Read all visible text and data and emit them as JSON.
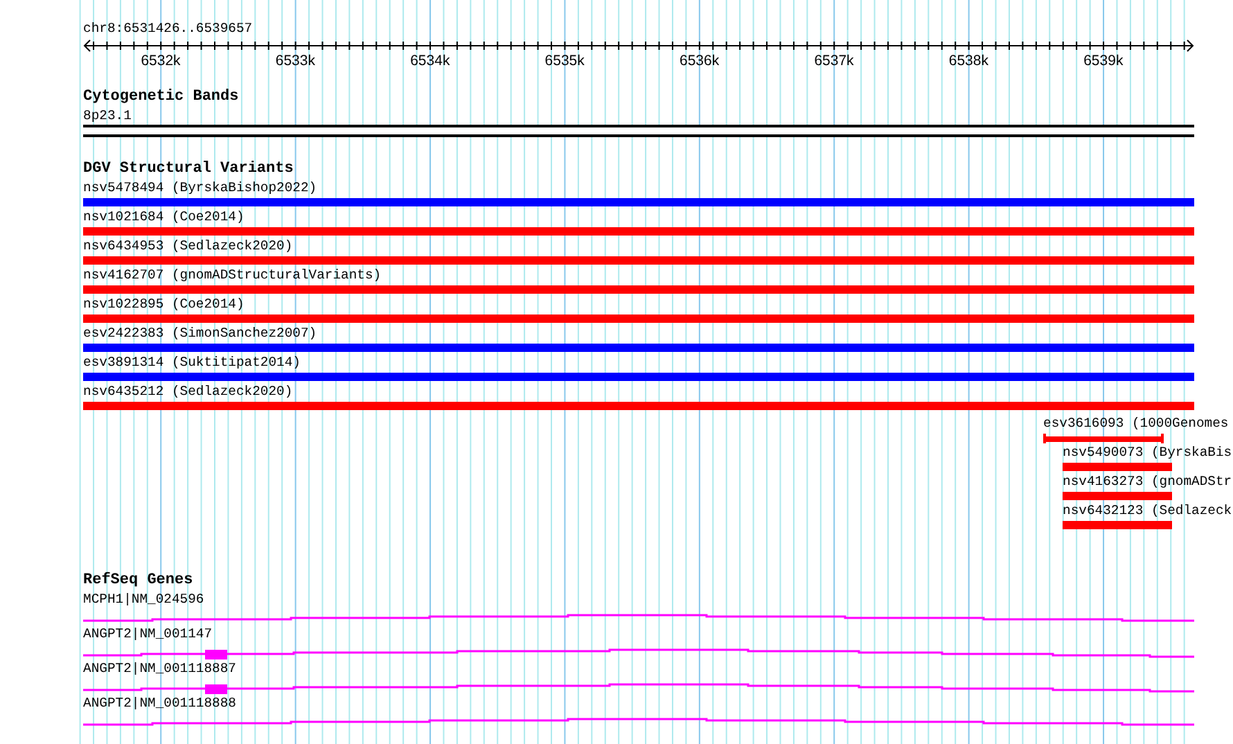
{
  "location": "chr8:6531426..6539657",
  "ruler": {
    "tick_labels": [
      "6532k",
      "6533k",
      "6534k",
      "6535k",
      "6536k",
      "6537k",
      "6538k",
      "6539k"
    ]
  },
  "cytogenetic": {
    "title": "Cytogenetic Bands",
    "bands": [
      {
        "label": "8p23.1"
      }
    ]
  },
  "dgv": {
    "title": "DGV Structural Variants",
    "variants": [
      {
        "label": "nsv5478494 (ByrskaBishop2022)",
        "color": "#0000ff",
        "kind": "plain"
      },
      {
        "label": "nsv1021684 (Coe2014)",
        "color": "#ff0000",
        "kind": "plain"
      },
      {
        "label": "nsv6434953 (Sedlazeck2020)",
        "color": "#ff0000",
        "kind": "plain"
      },
      {
        "label": "nsv4162707 (gnomADStructuralVariants)",
        "color": "#ff0000",
        "kind": "plain"
      },
      {
        "label": "nsv1022895 (Coe2014)",
        "color": "#ff0000",
        "kind": "plain"
      },
      {
        "label": "esv2422383 (SimonSanchez2007)",
        "color": "#0000ff",
        "kind": "plain"
      },
      {
        "label": "esv3891314 (Suktitipat2014)",
        "color": "#0000ff",
        "kind": "plain"
      },
      {
        "label": "nsv6435212 (Sedlazeck2020)",
        "color": "#ff0000",
        "kind": "plain"
      },
      {
        "label": "esv3616093 (1000Genomes",
        "color": "#ff0000",
        "kind": "capped"
      },
      {
        "label": "nsv5490073 (ByrskaBis",
        "color": "#ff0000",
        "kind": "plain"
      },
      {
        "label": "nsv4163273 (gnomADStr",
        "color": "#ff0000",
        "kind": "plain"
      },
      {
        "label": "nsv6432123 (Sedlazeck",
        "color": "#ff0000",
        "kind": "plain"
      }
    ]
  },
  "refseq": {
    "title": "RefSeq Genes",
    "genes": [
      {
        "label": "MCPH1|NM_024596",
        "exon_shown": false
      },
      {
        "label": "ANGPT2|NM_001147",
        "exon_shown": true
      },
      {
        "label": "ANGPT2|NM_001118887",
        "exon_shown": true
      },
      {
        "label": "ANGPT2|NM_001118888",
        "exon_shown": false
      }
    ]
  }
}
